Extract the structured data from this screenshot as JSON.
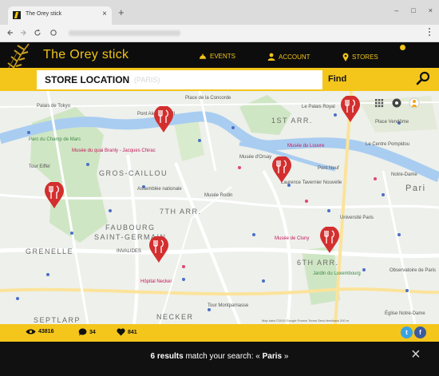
{
  "browser": {
    "tab_title": "The Orey stick",
    "tab_close": "×",
    "new_tab": "+",
    "window_controls": [
      "–",
      "□",
      "×"
    ]
  },
  "header": {
    "brand": "The Orey stick",
    "nav": [
      {
        "label": "EVENTS",
        "icon": "dish-icon"
      },
      {
        "label": "ACCOUNT",
        "icon": "user-icon"
      },
      {
        "label": "STORES",
        "icon": "location-pin-icon"
      }
    ],
    "colors": {
      "accent": "#f0c419",
      "background": "#0d0d0d"
    }
  },
  "search": {
    "label": "STORE LOCATION",
    "placeholder": "(PARIS)",
    "find_label": "Find",
    "icon": "magnifier-icon"
  },
  "map": {
    "district_labels": [
      "1ST ARR.",
      "7TH ARR.",
      "6TH ARR.",
      "GROS-CAILLOU",
      "FAUBOURG",
      "SAINT-GERMAIN",
      "GRENELLE",
      "NECKER",
      "SEPTLARP",
      "Pari"
    ],
    "place_labels": [
      "Palais de Tokyo",
      "Place de la Concorde",
      "Le Palais Royal",
      "Pont Alexandre III",
      "Musée du Louvre",
      "Le Centre Pompidou",
      "Musée du quai Branly - Jacques Chirac",
      "Musée d'Orsay",
      "Tour Eiffel",
      "Parc du Champ de Mars",
      "Assemblée nationale",
      "Musée Rodin",
      "Laurence Tavernier Nouvelle",
      "Pont Neuf",
      "Université Paris",
      "Jardin du Luxembourg",
      "Notre-Dame",
      "Tour Montparnasse",
      "Église Notre-Dame",
      "Hôpital Necker",
      "Place Vendôme",
      "INVALIDES",
      "Observatoire de Paris",
      "Musée de Cluny"
    ],
    "attribution": "Map data ©2019 Google   France   Terms   Send feedback   200 m"
  },
  "stats": {
    "views": "43816",
    "comments": "34",
    "likes": "841"
  },
  "social": [
    {
      "name": "twitter-icon",
      "glyph": "t",
      "color": "#3aa3e3"
    },
    {
      "name": "facebook-icon",
      "glyph": "f",
      "color": "#3b5ba0"
    }
  ],
  "results": {
    "count_text": "6 results",
    "middle_text": " match your search: «",
    "query": "Paris",
    "end_text": "»",
    "close": "×"
  }
}
